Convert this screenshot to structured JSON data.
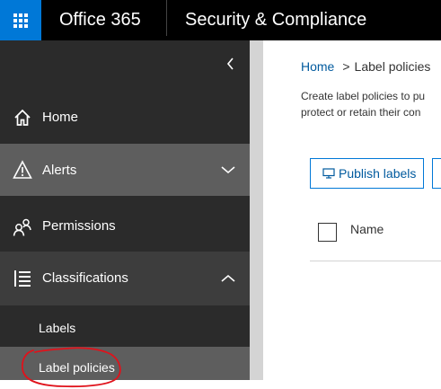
{
  "header": {
    "brand": "Office 365",
    "app_title": "Security & Compliance",
    "accent_color": "#0078d7",
    "icons": [
      "app-launcher-icon"
    ]
  },
  "sidebar": {
    "collapse_icon": "chevron-left-icon",
    "items": [
      {
        "label": "Home",
        "icon": "home-icon"
      },
      {
        "label": "Alerts",
        "icon": "warning-icon",
        "expand_icon": "chevron-down-icon"
      },
      {
        "label": "Permissions",
        "icon": "people-icon"
      },
      {
        "label": "Classifications",
        "icon": "list-icon",
        "expand_icon": "chevron-up-icon"
      }
    ],
    "subitems": [
      {
        "label": "Labels"
      },
      {
        "label": "Label policies",
        "selected": true
      }
    ],
    "annotation_color": "#e0121b"
  },
  "main": {
    "breadcrumb": {
      "home": "Home",
      "separator": ">",
      "current": "Label policies"
    },
    "description_line1": "Create label policies to pu",
    "description_line2": "protect or retain their con",
    "publish_button": "Publish labels",
    "table": {
      "columns": [
        "Name"
      ]
    }
  }
}
